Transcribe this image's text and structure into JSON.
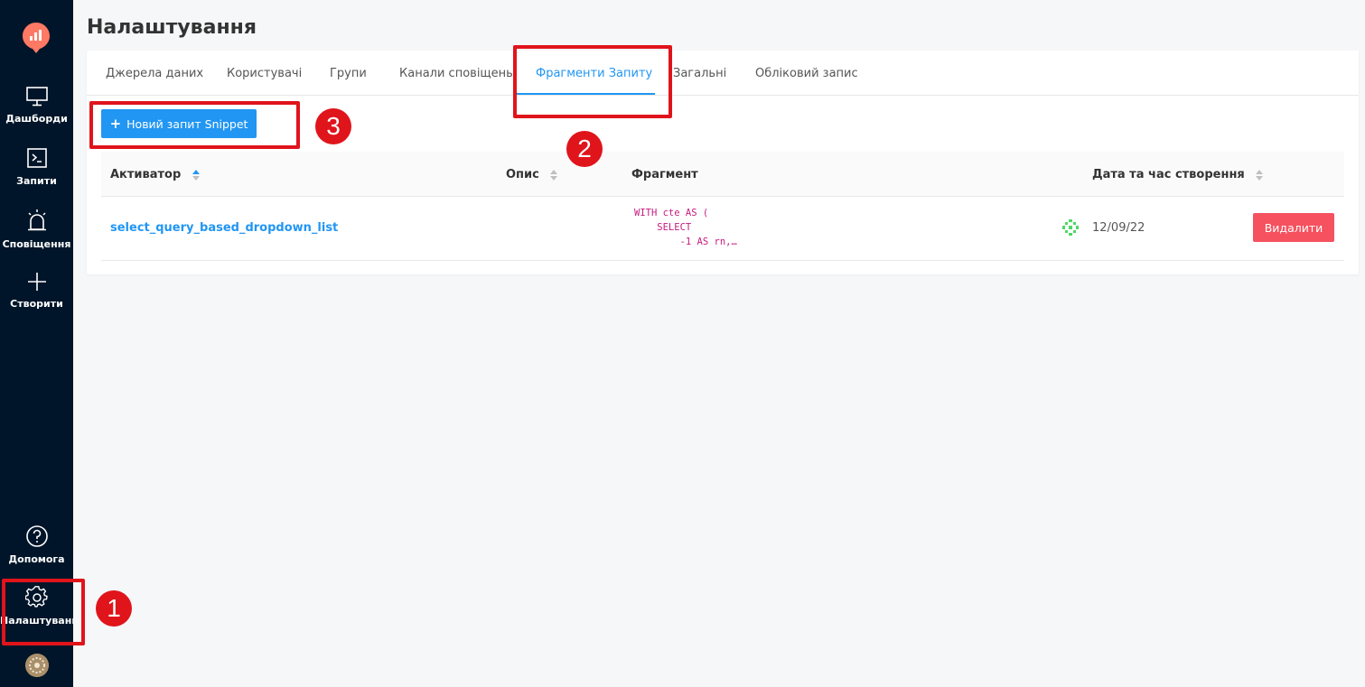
{
  "sidebar": {
    "items": [
      {
        "label": "Дашборди",
        "icon": "monitor-icon"
      },
      {
        "label": "Запити",
        "icon": "terminal-icon"
      },
      {
        "label": "Сповіщення",
        "icon": "alarm-icon"
      },
      {
        "label": "Створити",
        "icon": "plus-icon"
      }
    ],
    "bottom": [
      {
        "label": "Допомога",
        "icon": "help-icon"
      },
      {
        "label": "Налаштування",
        "icon": "gear-icon"
      }
    ]
  },
  "page": {
    "title": "Налаштування"
  },
  "tabs": [
    {
      "label": "Джерела даних",
      "active": false
    },
    {
      "label": "Користувачі",
      "active": false
    },
    {
      "label": "Групи",
      "active": false
    },
    {
      "label": "Канали сповіщень",
      "active": false
    },
    {
      "label": "Фрагменти Запиту",
      "active": true
    },
    {
      "label": "Загальні",
      "active": false
    },
    {
      "label": "Обліковий запис",
      "active": false
    }
  ],
  "new_snippet_button": {
    "label": "Новий запит Snippet"
  },
  "table": {
    "columns": [
      "Активатор",
      "Опис",
      "Фрагмент",
      "Дата та час створення"
    ],
    "rows": [
      {
        "trigger": "select_query_based_dropdown_list",
        "description": "",
        "snippet_lines": [
          "WITH cte AS (",
          "    SELECT",
          "        -1 AS rn,…"
        ],
        "created": "12/09/22",
        "delete_label": "Видалити"
      }
    ]
  },
  "annotations": [
    "1",
    "2",
    "3"
  ],
  "colors": {
    "sidebar_bg": "#001529",
    "accent": "#2196f3",
    "danger": "#f5515f",
    "annotation": "#e0141b",
    "snippet_text": "#c41d7f"
  }
}
